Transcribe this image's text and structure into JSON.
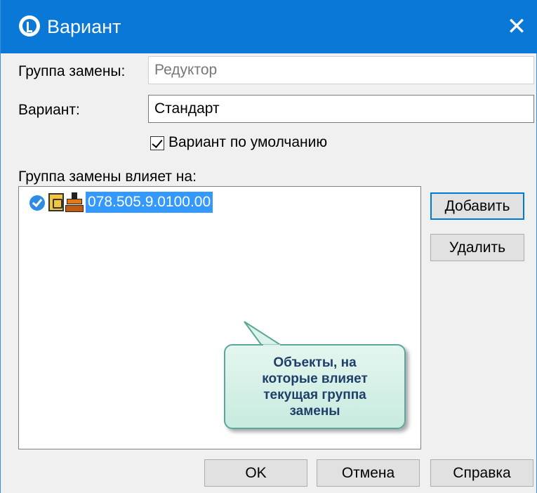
{
  "window": {
    "title": "Вариант",
    "close_glyph": "✕"
  },
  "form": {
    "group_label": "Группа замены:",
    "group_value": "Редуктор",
    "variant_label": "Вариант:",
    "variant_value": "Стандарт",
    "default_checkbox_label": "Вариант по умолчанию",
    "default_checked": true,
    "affects_label": "Группа замены влияет на:"
  },
  "list": {
    "items": [
      {
        "label": "078.505.9.0100.00",
        "icons": [
          "verified-icon",
          "document-icon",
          "assembly-icon"
        ],
        "selected": true
      }
    ]
  },
  "side_buttons": {
    "add": "Добавить",
    "remove": "Удалить"
  },
  "callout": {
    "text": "Объекты, на которые влияет текущая группа замены"
  },
  "footer": {
    "ok": "OK",
    "cancel": "Отмена",
    "help": "Справка"
  },
  "colors": {
    "titlebar": "#0a78d7",
    "selection": "#3399ff",
    "callout_fill": "#d6f0e6",
    "callout_border": "#5ba79c"
  }
}
